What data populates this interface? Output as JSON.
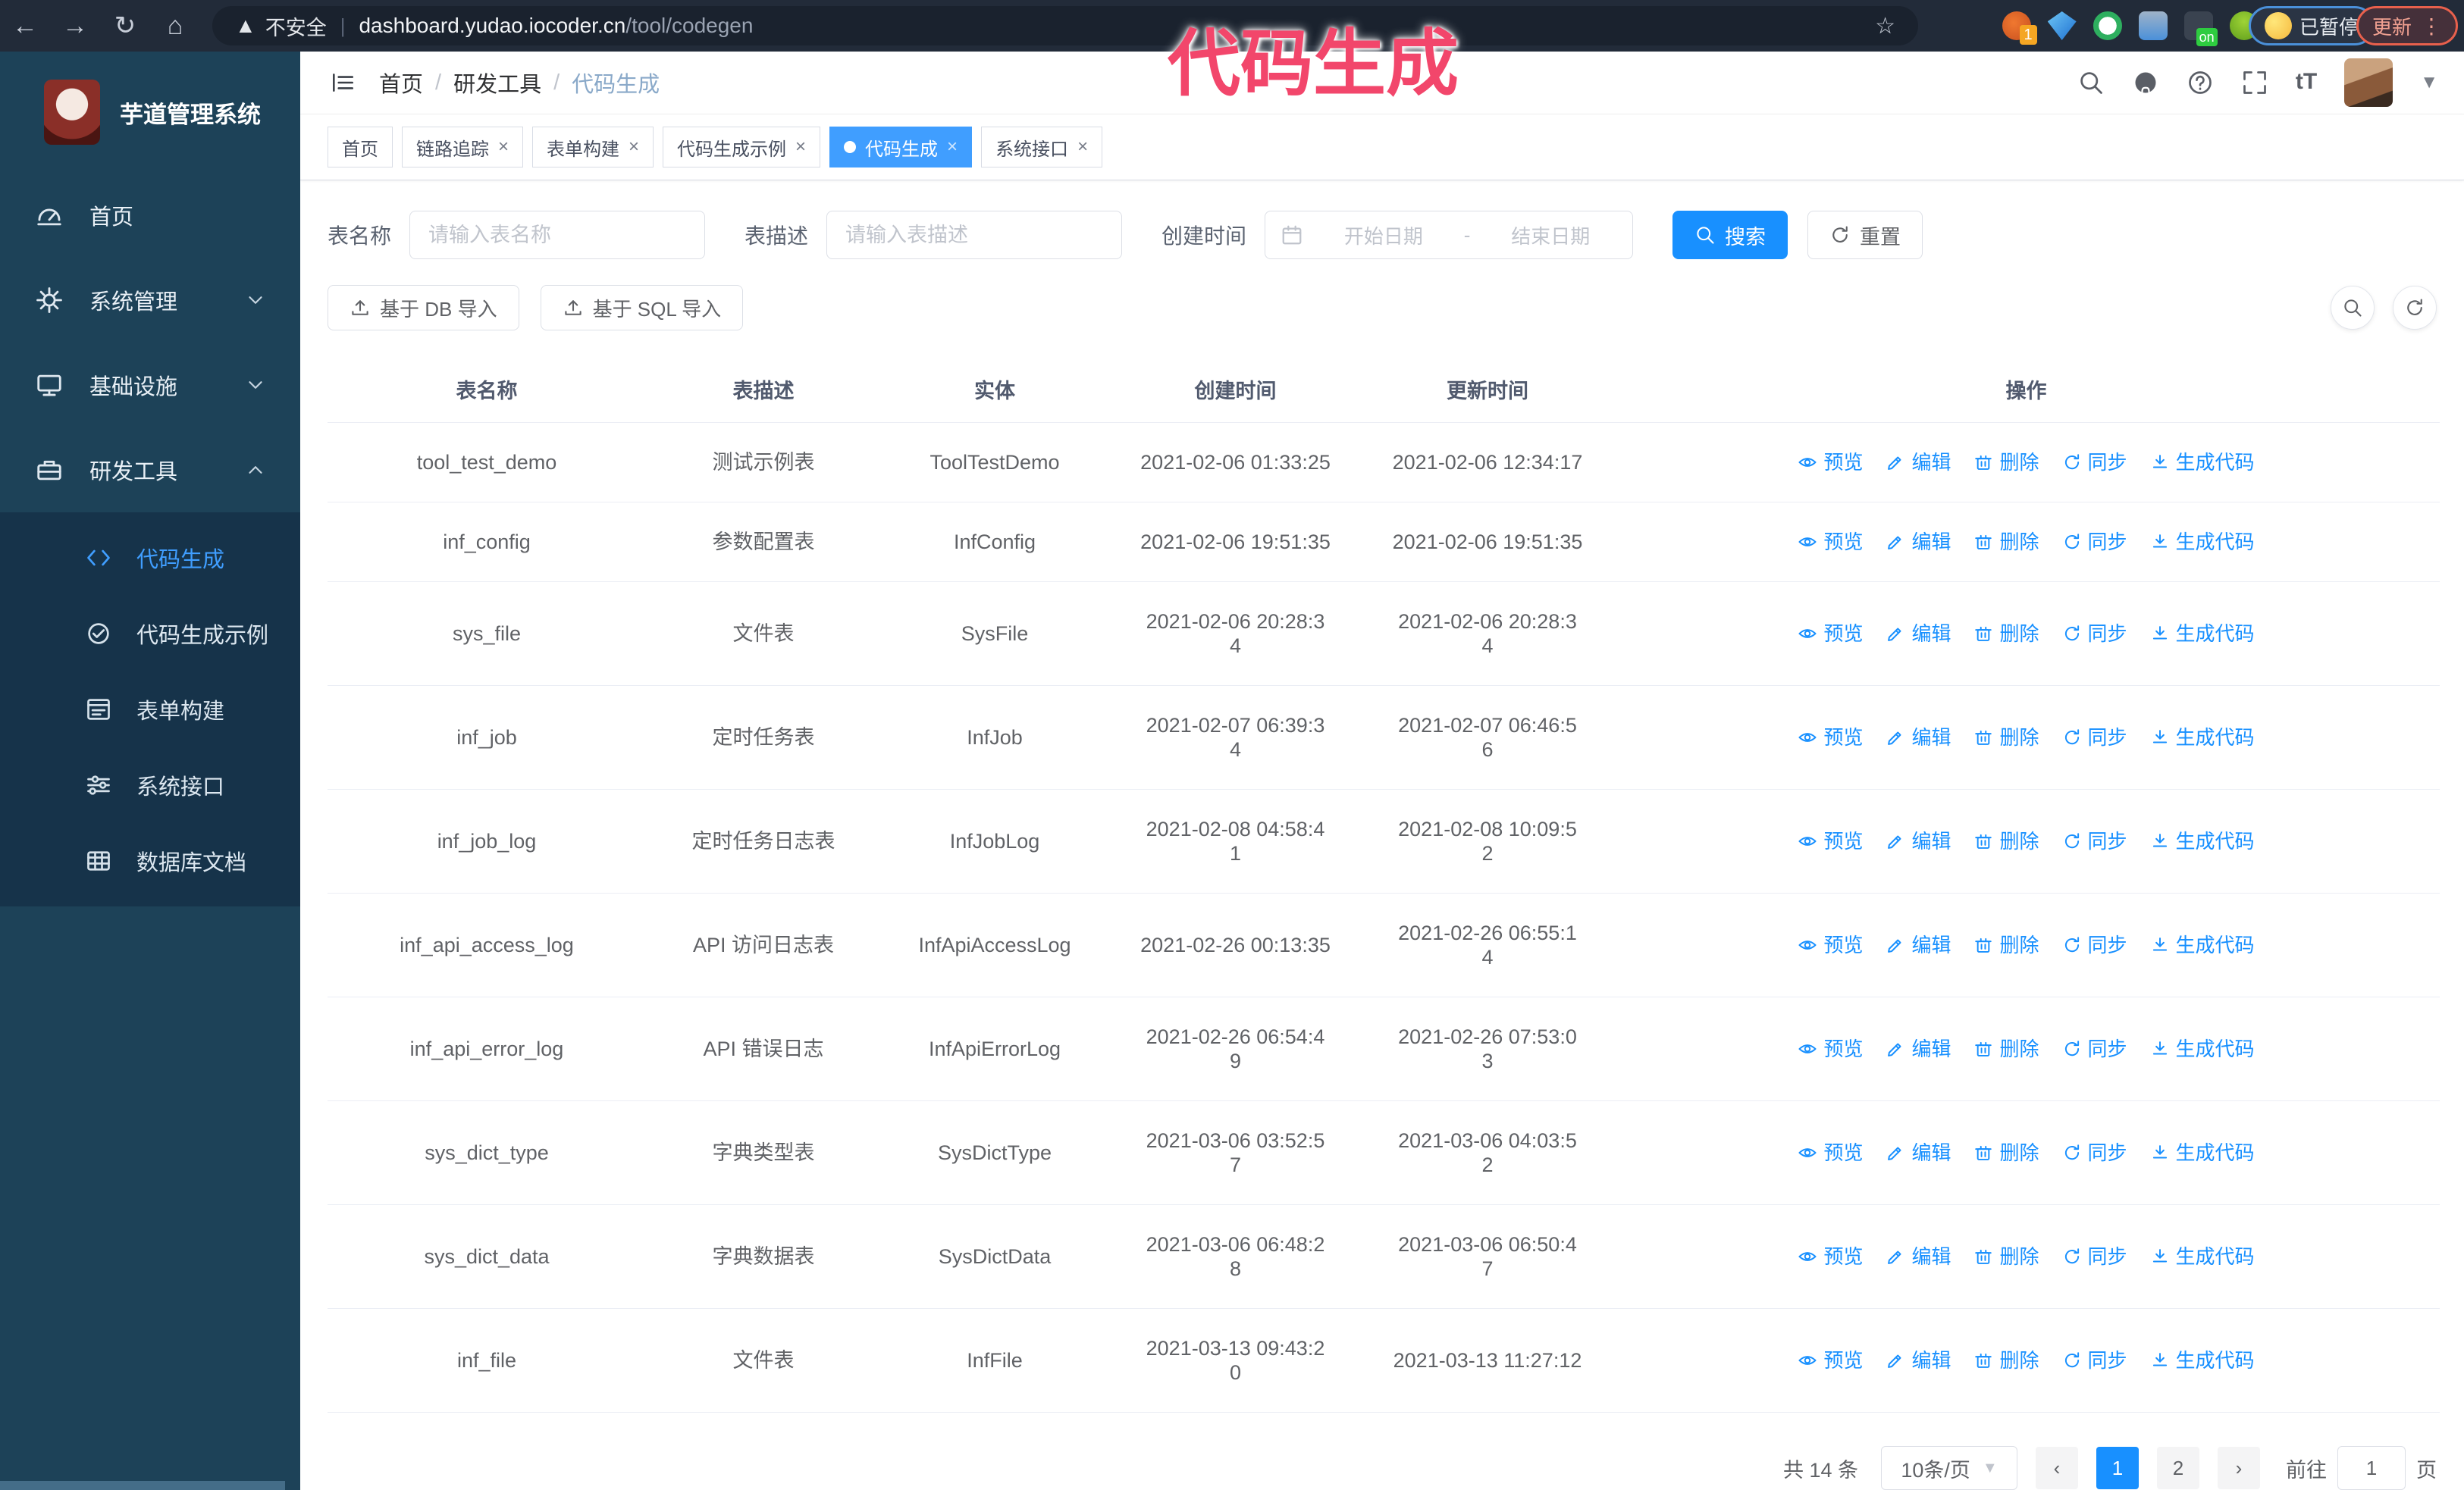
{
  "colors": {
    "primary": "#409eff",
    "link": "#1890ff",
    "annotation": "#f2466b",
    "sidebar_bg": "#1d4258",
    "submenu_bg": "#16334a",
    "chrome_bg": "#222b39"
  },
  "browser": {
    "security_label": "不安全",
    "url_host": "dashboard.yudao.iocoder.cn",
    "url_path": "/tool/codegen",
    "extension_badge": "1",
    "on_badge": "on",
    "paused_label": "已暂停",
    "update_label": "更新"
  },
  "annotation": {
    "text": "代码生成"
  },
  "sidebar": {
    "app_title": "芋道管理系统",
    "items": [
      {
        "label": "首页",
        "icon": "dashboard-icon",
        "chevron": ""
      },
      {
        "label": "系统管理",
        "icon": "gear-icon",
        "chevron": "down"
      },
      {
        "label": "基础设施",
        "icon": "monitor-icon",
        "chevron": "down"
      },
      {
        "label": "研发工具",
        "icon": "toolbox-icon",
        "chevron": "up"
      }
    ],
    "submenu": [
      {
        "label": "代码生成",
        "icon": "code-icon",
        "active": true
      },
      {
        "label": "代码生成示例",
        "icon": "example-icon",
        "active": false
      },
      {
        "label": "表单构建",
        "icon": "form-icon",
        "active": false
      },
      {
        "label": "系统接口",
        "icon": "api-icon",
        "active": false
      },
      {
        "label": "数据库文档",
        "icon": "db-icon",
        "active": false
      }
    ]
  },
  "breadcrumb": [
    "首页",
    "研发工具",
    "代码生成"
  ],
  "tabs": [
    {
      "label": "首页",
      "closable": false,
      "active": false
    },
    {
      "label": "链路追踪",
      "closable": true,
      "active": false
    },
    {
      "label": "表单构建",
      "closable": true,
      "active": false
    },
    {
      "label": "代码生成示例",
      "closable": true,
      "active": false
    },
    {
      "label": "代码生成",
      "closable": true,
      "active": true
    },
    {
      "label": "系统接口",
      "closable": true,
      "active": false
    }
  ],
  "filters": {
    "table_name_label": "表名称",
    "table_name_placeholder": "请输入表名称",
    "table_desc_label": "表描述",
    "table_desc_placeholder": "请输入表描述",
    "create_time_label": "创建时间",
    "date_start_placeholder": "开始日期",
    "date_separator": "-",
    "date_end_placeholder": "结束日期",
    "search_label": "搜索",
    "reset_label": "重置"
  },
  "toolbar": {
    "import_db_label": "基于 DB 导入",
    "import_sql_label": "基于 SQL 导入"
  },
  "table": {
    "columns": [
      "表名称",
      "表描述",
      "实体",
      "创建时间",
      "更新时间",
      "操作"
    ],
    "actions": [
      {
        "label": "预览",
        "icon": "eye-icon"
      },
      {
        "label": "编辑",
        "icon": "edit-icon"
      },
      {
        "label": "删除",
        "icon": "trash-icon"
      },
      {
        "label": "同步",
        "icon": "sync-icon"
      },
      {
        "label": "生成代码",
        "icon": "download-icon"
      }
    ],
    "rows": [
      {
        "name": "tool_test_demo",
        "desc": "测试示例表",
        "entity": "ToolTestDemo",
        "created": "2021-02-06 01:33:25",
        "updated": "2021-02-06 12:34:17"
      },
      {
        "name": "inf_config",
        "desc": "参数配置表",
        "entity": "InfConfig",
        "created": "2021-02-06 19:51:35",
        "updated": "2021-02-06 19:51:35"
      },
      {
        "name": "sys_file",
        "desc": "文件表",
        "entity": "SysFile",
        "created": "2021-02-06 20:28:3\n4",
        "updated": "2021-02-06 20:28:3\n4"
      },
      {
        "name": "inf_job",
        "desc": "定时任务表",
        "entity": "InfJob",
        "created": "2021-02-07 06:39:3\n4",
        "updated": "2021-02-07 06:46:5\n6"
      },
      {
        "name": "inf_job_log",
        "desc": "定时任务日志表",
        "entity": "InfJobLog",
        "created": "2021-02-08 04:58:4\n1",
        "updated": "2021-02-08 10:09:5\n2"
      },
      {
        "name": "inf_api_access_log",
        "desc": "API 访问日志表",
        "entity": "InfApiAccessLog",
        "created": "2021-02-26 00:13:35",
        "updated": "2021-02-26 06:55:1\n4"
      },
      {
        "name": "inf_api_error_log",
        "desc": "API 错误日志",
        "entity": "InfApiErrorLog",
        "created": "2021-02-26 06:54:4\n9",
        "updated": "2021-02-26 07:53:0\n3"
      },
      {
        "name": "sys_dict_type",
        "desc": "字典类型表",
        "entity": "SysDictType",
        "created": "2021-03-06 03:52:5\n7",
        "updated": "2021-03-06 04:03:5\n2"
      },
      {
        "name": "sys_dict_data",
        "desc": "字典数据表",
        "entity": "SysDictData",
        "created": "2021-03-06 06:48:2\n8",
        "updated": "2021-03-06 06:50:4\n7"
      },
      {
        "name": "inf_file",
        "desc": "文件表",
        "entity": "InfFile",
        "created": "2021-03-13 09:43:2\n0",
        "updated": "2021-03-13 11:27:12"
      }
    ]
  },
  "pagination": {
    "total_label": "共 14 条",
    "page_size_label": "10条/页",
    "pages": [
      "1",
      "2"
    ],
    "current_page": "1",
    "goto_label": "前往",
    "goto_value": "1",
    "page_unit": "页"
  }
}
